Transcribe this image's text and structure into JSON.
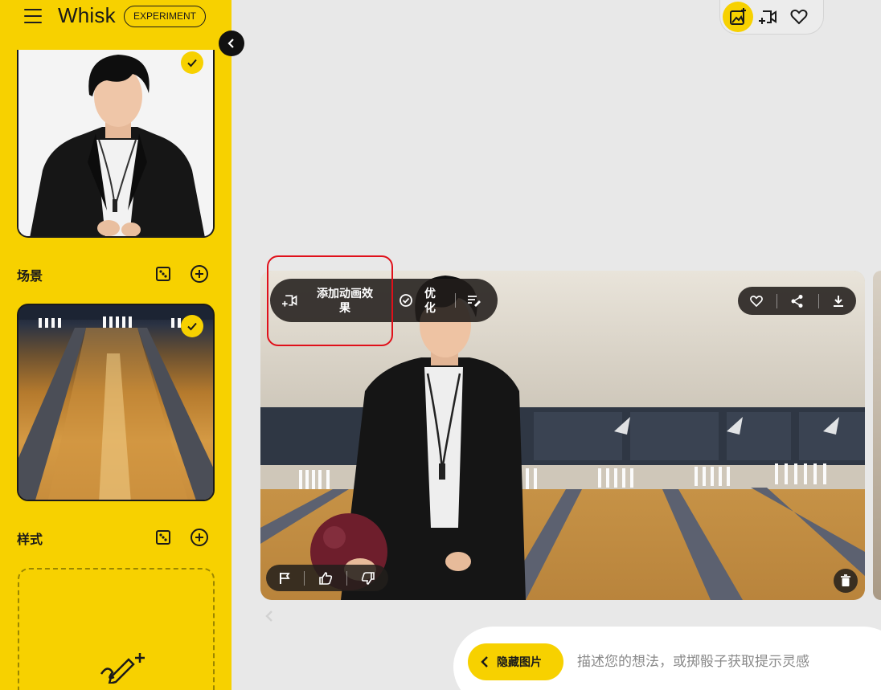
{
  "app": {
    "title": "Whisk",
    "badge": "EXPERIMENT"
  },
  "sidebar": {
    "sections": {
      "scene": {
        "title": "场景"
      },
      "style": {
        "title": "样式"
      }
    }
  },
  "image_card": {
    "animate_label": "添加动画效果",
    "animate_label_line1": "添加动画效",
    "animate_label_line2": "果",
    "refine_label": "优化",
    "refine_line1": "优",
    "refine_line2": "化"
  },
  "prompt": {
    "hide_images_label": "隐藏图片",
    "placeholder": "描述您的想法，或掷骰子获取提示灵感"
  },
  "colors": {
    "accent": "#f7d100",
    "annotation": "#e0101a",
    "overlay": "#221e1b"
  },
  "icons": [
    "menu-icon",
    "collapse-chevron-icon",
    "check-icon",
    "dice-icon",
    "add-circle-icon",
    "image-add-icon",
    "video-add-icon",
    "heart-icon",
    "share-icon",
    "download-icon",
    "flag-icon",
    "thumbs-up-icon",
    "thumbs-down-icon",
    "trash-icon",
    "refine-check-icon",
    "edit-text-icon",
    "pencil-sparkle-icon",
    "chevron-left-icon"
  ]
}
